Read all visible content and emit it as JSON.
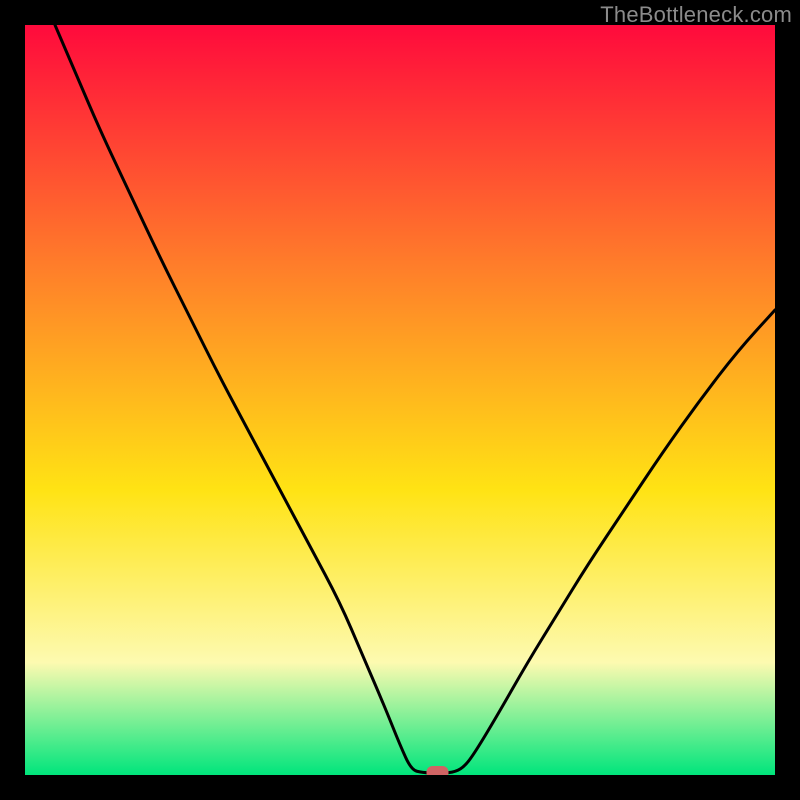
{
  "watermark": "TheBottleneck.com",
  "chart_data": {
    "type": "line",
    "title": "",
    "xlabel": "",
    "ylabel": "",
    "xlim": [
      0,
      100
    ],
    "ylim": [
      0,
      100
    ],
    "gradient_colors": {
      "top": "#ff0a3c",
      "upper_mid": "#ff7d2a",
      "mid": "#ffe314",
      "lower_mid": "#fdfab0",
      "bottom": "#00e57c"
    },
    "marker": {
      "x": 55,
      "y": 0,
      "color": "#d06464"
    },
    "series": [
      {
        "name": "curve",
        "points": [
          {
            "x": 4.0,
            "y": 100.0
          },
          {
            "x": 7.0,
            "y": 93.0
          },
          {
            "x": 10.0,
            "y": 86.0
          },
          {
            "x": 14.0,
            "y": 77.5
          },
          {
            "x": 18.0,
            "y": 69.0
          },
          {
            "x": 22.0,
            "y": 61.0
          },
          {
            "x": 26.0,
            "y": 53.0
          },
          {
            "x": 30.0,
            "y": 45.5
          },
          {
            "x": 34.0,
            "y": 38.0
          },
          {
            "x": 38.0,
            "y": 30.5
          },
          {
            "x": 42.0,
            "y": 23.0
          },
          {
            "x": 45.0,
            "y": 16.0
          },
          {
            "x": 48.0,
            "y": 9.0
          },
          {
            "x": 50.0,
            "y": 4.0
          },
          {
            "x": 51.5,
            "y": 0.7
          },
          {
            "x": 53.0,
            "y": 0.3
          },
          {
            "x": 55.0,
            "y": 0.3
          },
          {
            "x": 57.0,
            "y": 0.3
          },
          {
            "x": 58.5,
            "y": 1.0
          },
          {
            "x": 60.0,
            "y": 3.0
          },
          {
            "x": 63.0,
            "y": 8.0
          },
          {
            "x": 67.0,
            "y": 15.0
          },
          {
            "x": 71.0,
            "y": 21.5
          },
          {
            "x": 75.0,
            "y": 28.0
          },
          {
            "x": 80.0,
            "y": 35.5
          },
          {
            "x": 85.0,
            "y": 43.0
          },
          {
            "x": 90.0,
            "y": 50.0
          },
          {
            "x": 95.0,
            "y": 56.5
          },
          {
            "x": 100.0,
            "y": 62.0
          }
        ]
      }
    ]
  }
}
